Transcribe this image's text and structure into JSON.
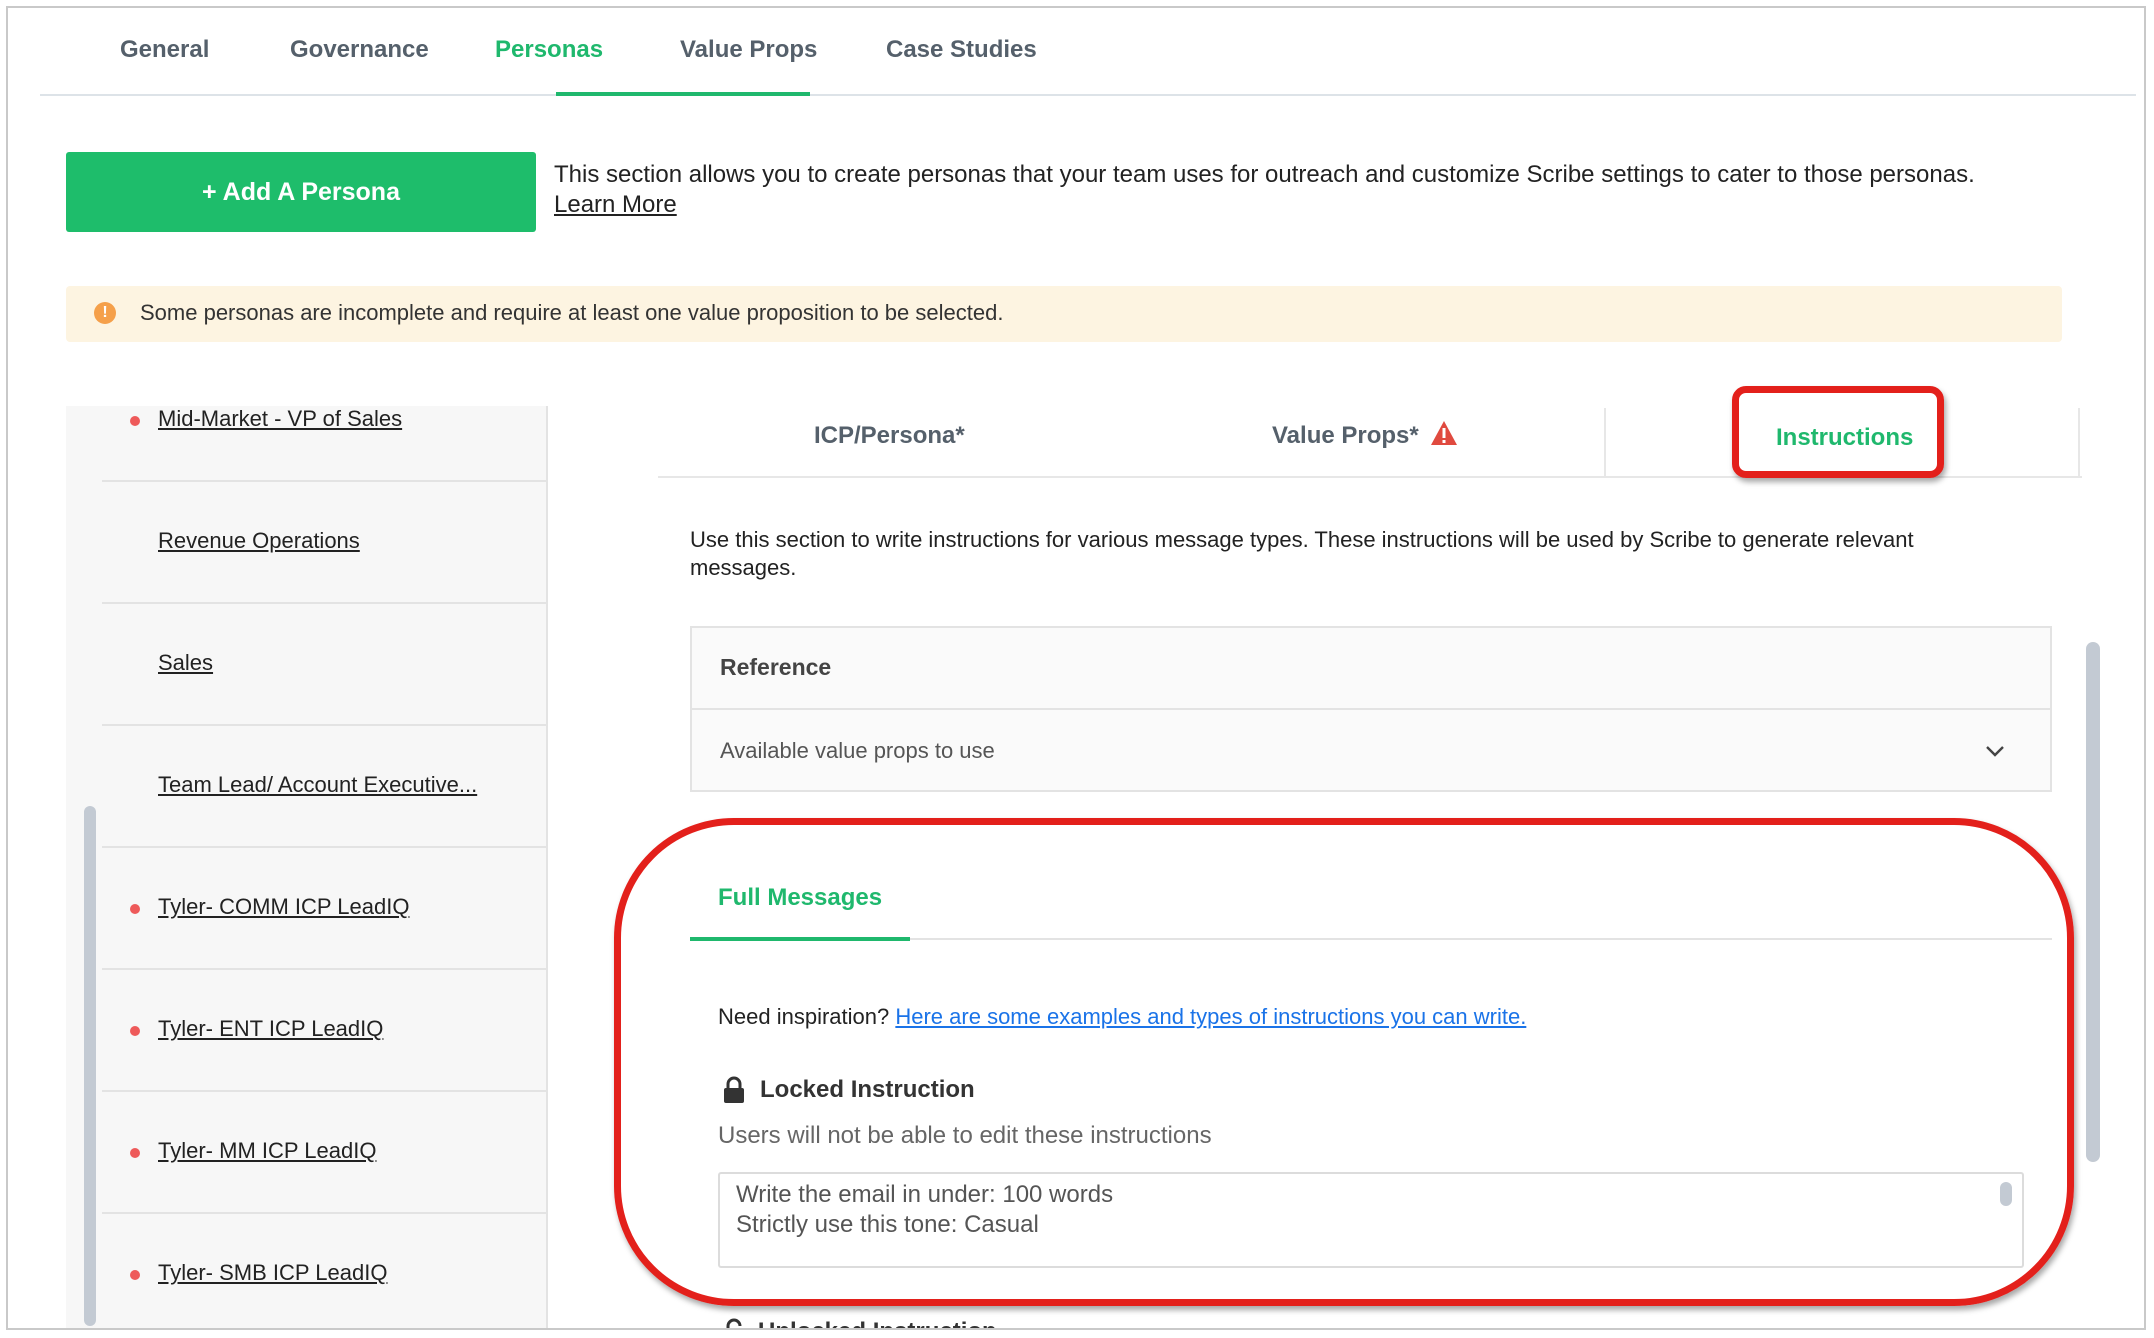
{
  "top_tabs": {
    "general": "General",
    "governance": "Governance",
    "personas": "Personas",
    "value_props": "Value Props",
    "case_studies": "Case Studies"
  },
  "add_persona_label": "+ Add A Persona",
  "intro": {
    "text": "This section allows you to create personas that your team uses for outreach and customize Scribe settings to cater to those personas.",
    "learn_more": "Learn More"
  },
  "warning": {
    "icon": "!",
    "text": "Some personas are incomplete and require at least one value proposition to be selected."
  },
  "sidebar": {
    "items": [
      {
        "label": "Mid-Market - VP of Sales",
        "incomplete": true
      },
      {
        "label": "Revenue Operations",
        "incomplete": false
      },
      {
        "label": "Sales",
        "incomplete": false
      },
      {
        "label": "Team Lead/ Account Executive...",
        "incomplete": false
      },
      {
        "label": "Tyler- COMM ICP LeadIQ",
        "incomplete": true
      },
      {
        "label": "Tyler- ENT ICP LeadIQ",
        "incomplete": true
      },
      {
        "label": "Tyler- MM ICP LeadIQ",
        "incomplete": true
      },
      {
        "label": "Tyler- SMB ICP LeadIQ",
        "incomplete": true
      }
    ]
  },
  "persona_tabs": {
    "icp": "ICP/Persona*",
    "value_props": "Value Props*",
    "instructions": "Instructions"
  },
  "instructions_desc": "Use this section to write instructions for various message types. These instructions will be used by Scribe to generate relevant messages.",
  "reference": {
    "title": "Reference",
    "row": "Available value props to use"
  },
  "full_messages": {
    "tab": "Full Messages",
    "inspiration_prefix": "Need inspiration?",
    "inspiration_link": "Here are some examples and types of instructions you can write.",
    "locked_title": "Locked Instruction",
    "locked_sub": "Users will not be able to edit these instructions",
    "locked_text": "Write the email in under: 100 words\nStrictly use this tone: Casual",
    "unlocked_title": "Unlocked Instruction"
  },
  "colors": {
    "accent": "#1fb86d",
    "warning_bg": "#fdf4e1",
    "incomplete_dot": "#ee5a5a",
    "annotation": "#e3201b",
    "link": "#1a73e8"
  }
}
